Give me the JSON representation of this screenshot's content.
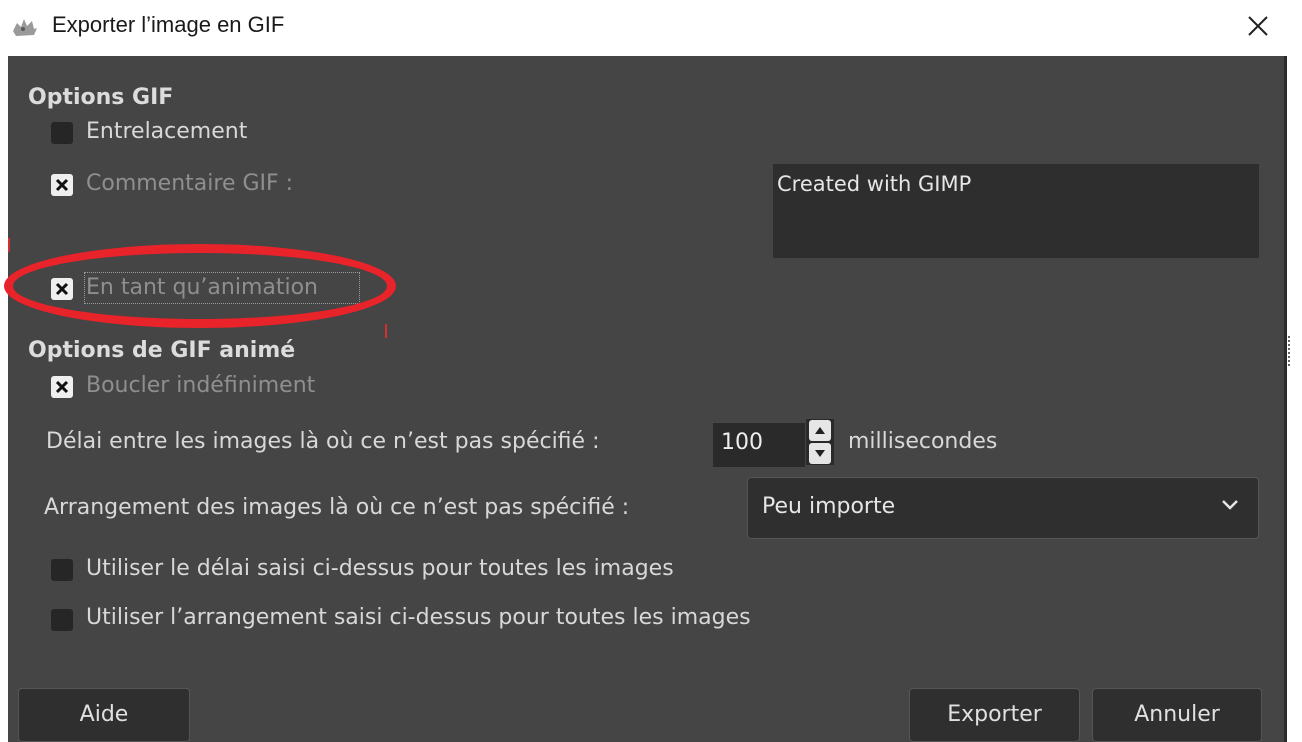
{
  "window": {
    "title": "Exporter l’image en GIF",
    "app_icon": "gimp-wilber-icon",
    "close_icon": "close-icon"
  },
  "gif_options": {
    "heading": "Options GIF",
    "interlace": {
      "label": "Entrelacement",
      "checked": false
    },
    "comment": {
      "label": "Commentaire  GIF :",
      "checked": true,
      "value": "Created with GIMP"
    },
    "as_animation": {
      "label": "En tant qu’animation",
      "checked": true
    }
  },
  "animated_options": {
    "heading": "Options de GIF animé",
    "loop_forever": {
      "label": "Boucler indéfiniment",
      "checked": true
    },
    "delay": {
      "label": "Délai entre les images là où ce n’est pas spécifié :",
      "value": "100",
      "unit": "millisecondes"
    },
    "disposal": {
      "label": "Arrangement des images là où ce n’est pas spécifié :",
      "selected": "Peu importe"
    },
    "use_delay_all": {
      "label": "Utiliser le délai saisi ci-dessus pour toutes les images",
      "checked": false
    },
    "use_disposal_all": {
      "label": "Utiliser l’arrangement saisi ci-dessus pour toutes les images",
      "checked": false
    }
  },
  "buttons": {
    "help": "Aide",
    "export": "Exporter",
    "cancel": "Annuler"
  },
  "colors": {
    "dialog_bg": "#454545",
    "annotation": "#e8232a"
  }
}
